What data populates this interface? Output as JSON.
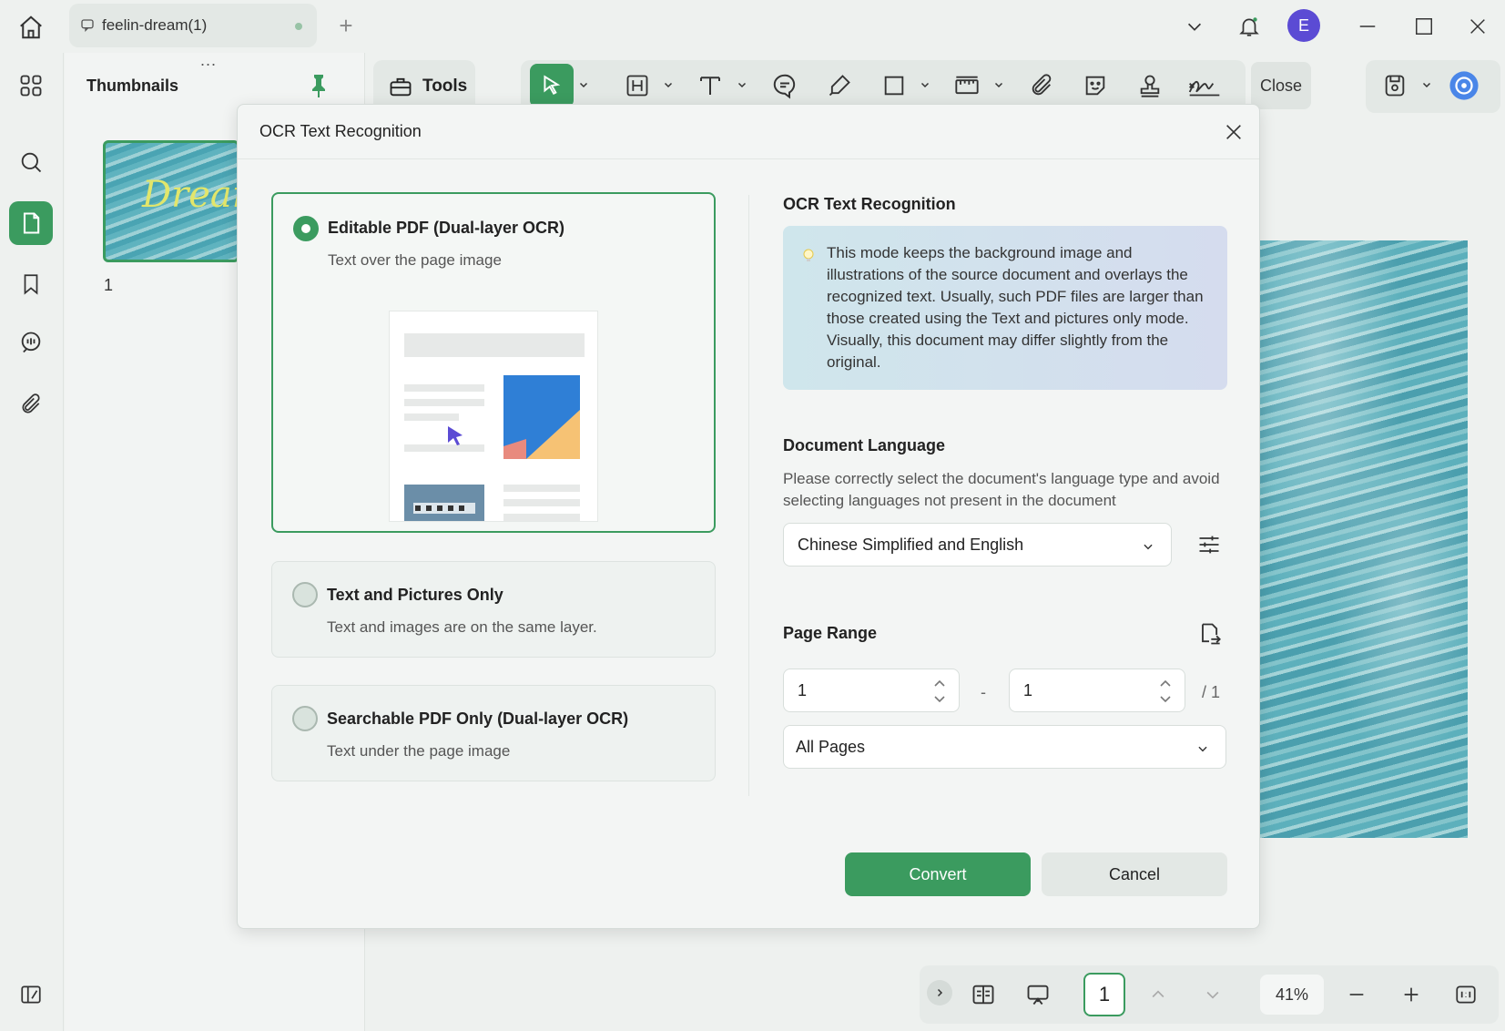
{
  "titlebar": {
    "tab_title": "feelin-dream(1)",
    "avatar_initial": "E"
  },
  "thumbnails": {
    "title": "Thumbnails",
    "more": "...",
    "page_number": "1",
    "thumb_text": "Dream"
  },
  "toolbar": {
    "tools_label": "Tools",
    "close_label": "Close"
  },
  "modal": {
    "title": "OCR Text Recognition",
    "options": [
      {
        "title": "Editable PDF (Dual-layer OCR)",
        "subtitle": "Text over the page image",
        "selected": true
      },
      {
        "title": "Text and Pictures Only",
        "subtitle": "Text and images are on the same layer.",
        "selected": false
      },
      {
        "title": "Searchable PDF Only (Dual-layer OCR)",
        "subtitle": "Text under the page image",
        "selected": false
      }
    ],
    "right": {
      "section_title": "OCR Text Recognition",
      "info_text": "This mode keeps the background image and illustrations of the source document and overlays the recognized text. Usually, such PDF files are larger than those created using the Text and pictures only mode. Visually, this document may differ slightly from the original.",
      "language_title": "Document Language",
      "language_desc": "Please correctly select the document's language type and avoid selecting languages not present in the document",
      "language_value": "Chinese Simplified and English",
      "page_range_title": "Page Range",
      "range_from": "1",
      "range_to": "1",
      "range_dash": "-",
      "range_total": "/ 1",
      "pages_value": "All Pages"
    },
    "convert_label": "Convert",
    "cancel_label": "Cancel"
  },
  "bottom_bar": {
    "current_page": "1",
    "zoom": "41%"
  },
  "colors": {
    "accent": "#3b9b5f",
    "avatar": "#5b4bd4"
  }
}
